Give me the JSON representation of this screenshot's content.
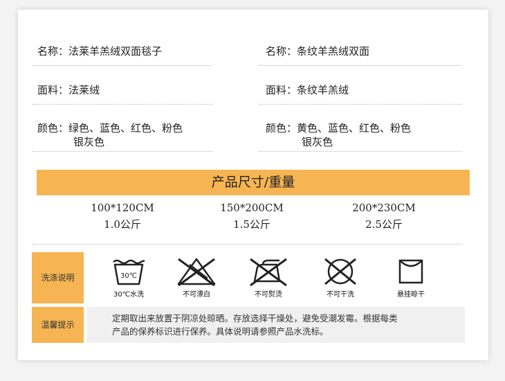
{
  "specs": {
    "left": {
      "name": {
        "label": "名称：",
        "value": "法莱羊羔绒双面毯子"
      },
      "fabric": {
        "label": "面料：",
        "value": "法莱绒"
      },
      "color": {
        "label": "颜色：",
        "value": "绿色、蓝色、红色、粉色",
        "value2": "银灰色"
      }
    },
    "right": {
      "name": {
        "label": "名称：",
        "value": "条纹羊羔绒双面"
      },
      "fabric": {
        "label": "面料：",
        "value": "条纹羊羔绒"
      },
      "color": {
        "label": "颜色：",
        "value": "黄色、蓝色、红色、粉色",
        "value2": "银灰色"
      }
    }
  },
  "size_section": {
    "title": "产品尺寸/重量",
    "sizes": [
      {
        "dimension": "100*120CM",
        "weight": "1.0公斤"
      },
      {
        "dimension": "150*200CM",
        "weight": "1.5公斤"
      },
      {
        "dimension": "200*230CM",
        "weight": "2.5公斤"
      }
    ]
  },
  "care": {
    "label": "洗涤说明",
    "icons": [
      {
        "icon": "wash-30-icon",
        "text": "30℃",
        "caption": "30℃水洗"
      },
      {
        "icon": "no-bleach-icon",
        "caption": "不可漂白"
      },
      {
        "icon": "no-iron-icon",
        "caption": "不可熨烫"
      },
      {
        "icon": "no-dry-clean-icon",
        "caption": "不可干洗"
      },
      {
        "icon": "hang-dry-icon",
        "caption": "悬挂晾干"
      }
    ]
  },
  "tips": {
    "label": "温馨提示",
    "line1": "定期取出来放置于阴凉处晾晒。存放选择干燥处，避免受潮发霉。根据每类",
    "line2": "产品的保养标识进行保养。具体说明请参照产品水洗标。"
  },
  "colors": {
    "accent": "#f6b552",
    "tips_bg": "#f0f0f0"
  }
}
